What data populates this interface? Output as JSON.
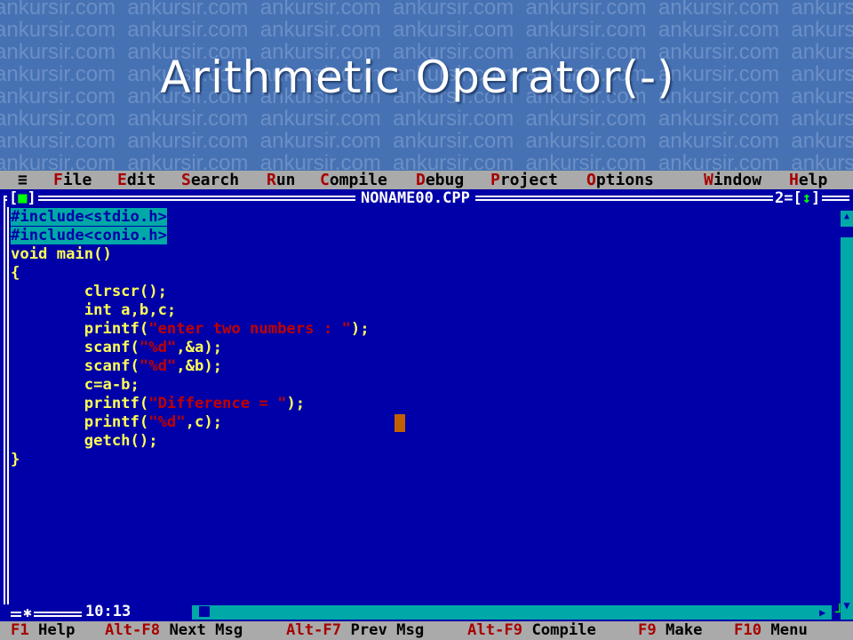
{
  "slide": {
    "title": "Arithmetic Operator(-)",
    "watermark": "ankursir.com"
  },
  "menubar": {
    "items": [
      {
        "label": "≡"
      },
      {
        "hot": "F",
        "rest": "ile"
      },
      {
        "hot": "E",
        "rest": "dit"
      },
      {
        "hot": "S",
        "rest": "earch"
      },
      {
        "hot": "R",
        "rest": "un"
      },
      {
        "hot": "C",
        "rest": "ompile"
      },
      {
        "hot": "D",
        "rest": "ebug"
      },
      {
        "hot": "P",
        "rest": "roject"
      },
      {
        "hot": "O",
        "rest": "ptions"
      },
      {
        "hot": "W",
        "rest": "indow"
      },
      {
        "hot": "H",
        "rest": "elp"
      }
    ]
  },
  "editor": {
    "close_box": "[■]",
    "filename": "NONAME00.CPP",
    "window_number": "2=[↕]",
    "position": "10:13",
    "lines": [
      {
        "selected": true,
        "text": "#include<stdio.h>"
      },
      {
        "selected": true,
        "text": "#include<conio.h>"
      },
      {
        "text": "void main()"
      },
      {
        "text": "{"
      },
      {
        "text": "        clrscr();"
      },
      {
        "text": "        int a,b,c;"
      },
      {
        "pre": "        printf(",
        "str": "\"enter two numbers : \"",
        "post": ");"
      },
      {
        "pre": "        scanf(",
        "str": "\"%d\"",
        "post": ",&a);"
      },
      {
        "pre": "        scanf(",
        "str": "\"%d\"",
        "post": ",&b);"
      },
      {
        "text": "        c=a-b;"
      },
      {
        "pre": "        printf(",
        "str": "\"Difference = \"",
        "post": ");"
      },
      {
        "pre": "        printf(",
        "str": "\"%d\"",
        "post": ",c);"
      },
      {
        "text": "        getch();"
      },
      {
        "text": "}"
      }
    ]
  },
  "function_keys": [
    {
      "key": "F1",
      "label": "Help"
    },
    {
      "key": "Alt-F8",
      "label": "Next Msg"
    },
    {
      "key": "Alt-F7",
      "label": "Prev Msg"
    },
    {
      "key": "Alt-F9",
      "label": "Compile"
    },
    {
      "key": "F9",
      "label": "Make"
    },
    {
      "key": "F10",
      "label": "Menu"
    }
  ],
  "colors": {
    "editor_bg": "#0000a8",
    "menu_bg": "#aaaaaa",
    "hotkey": "#a80000",
    "code_text": "#ffff55",
    "string_text": "#c00000",
    "selection": "#00a8a8"
  }
}
